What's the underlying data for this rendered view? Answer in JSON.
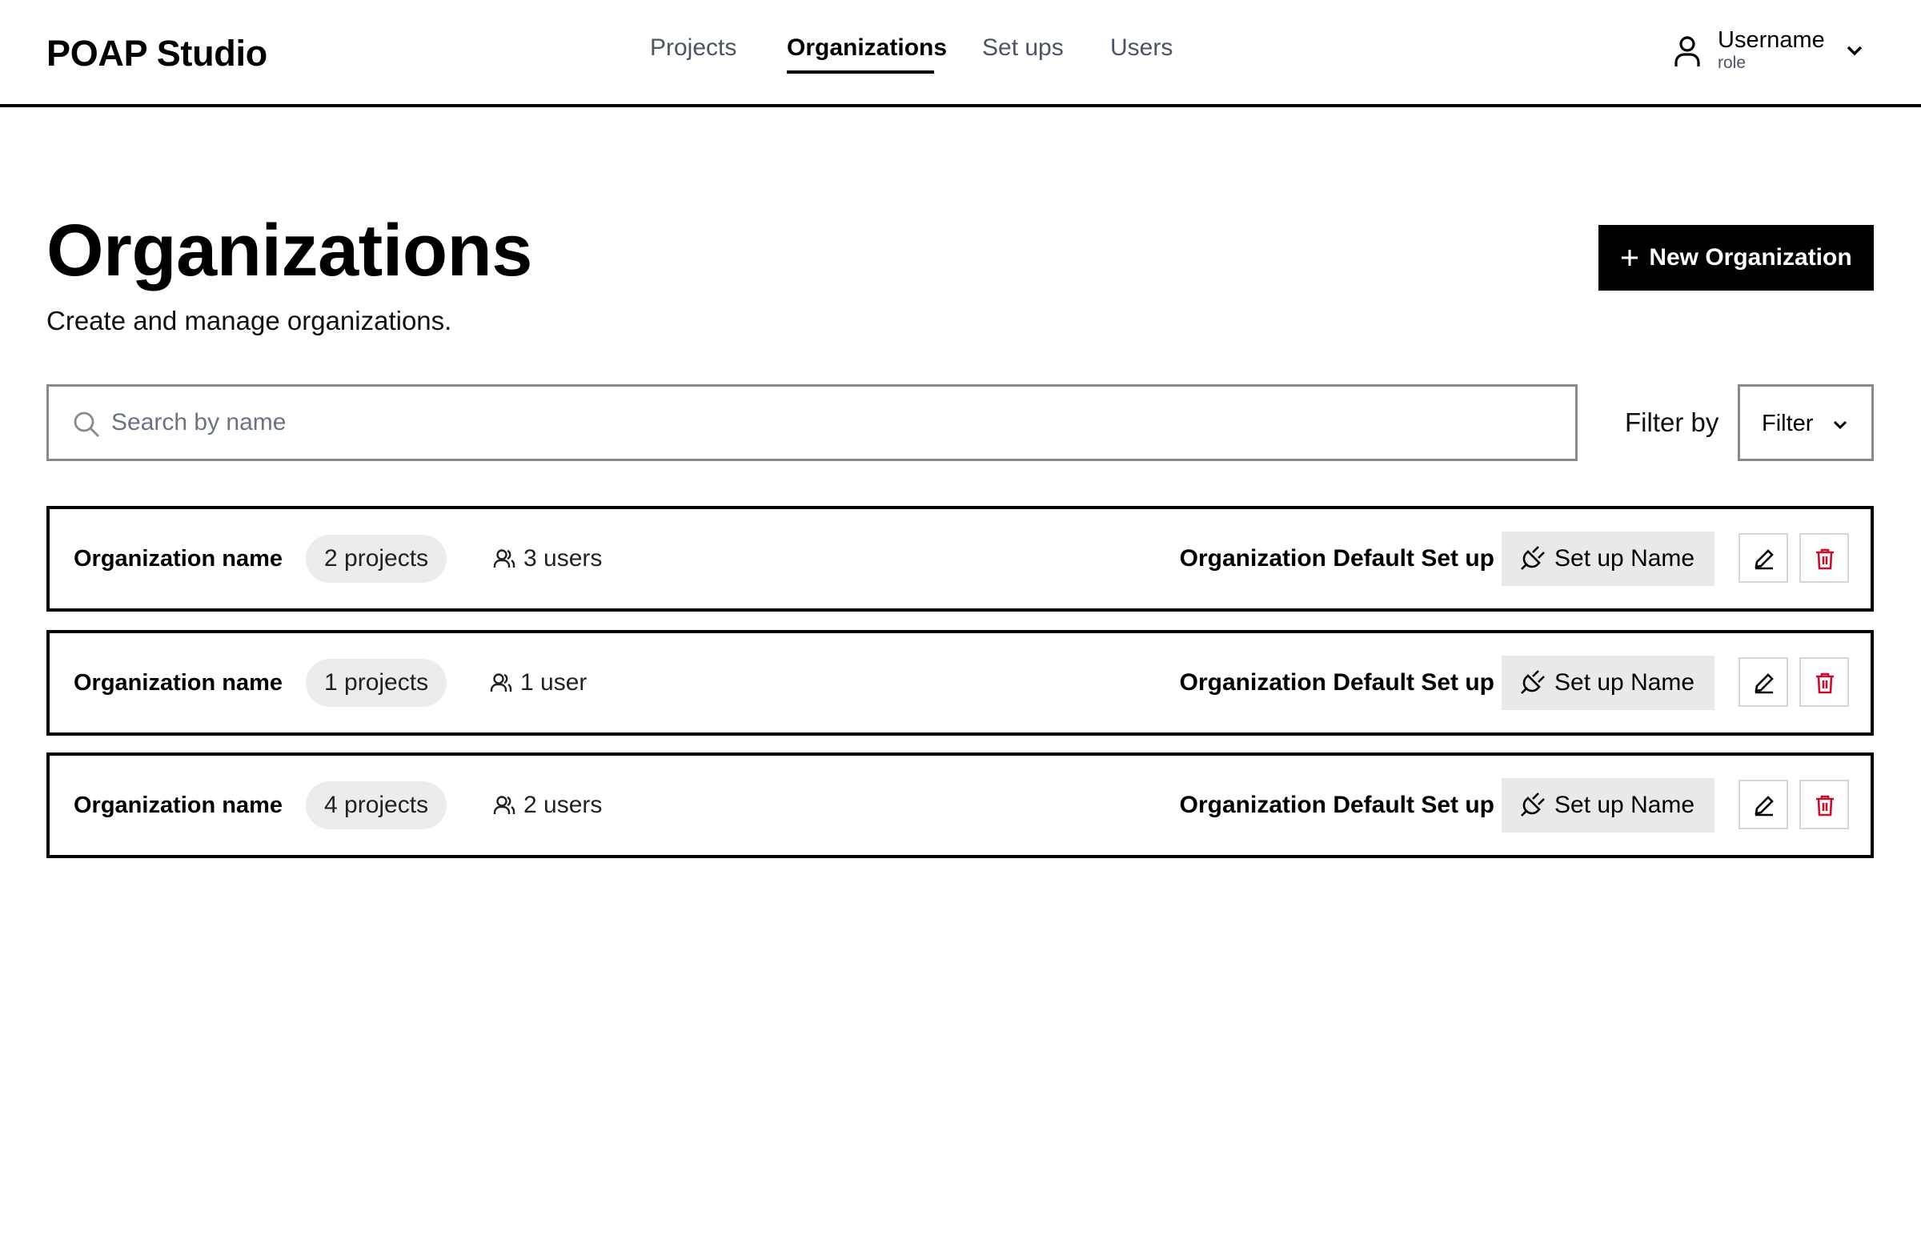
{
  "header": {
    "brand": "POAP Studio",
    "nav": [
      {
        "label": "Projects",
        "active": false
      },
      {
        "label": "Organizations",
        "active": true
      },
      {
        "label": "Set ups",
        "active": false
      },
      {
        "label": "Users",
        "active": false
      }
    ],
    "user": {
      "name": "Username",
      "role": "role"
    }
  },
  "page": {
    "title": "Organizations",
    "subtitle": "Create and manage organizations.",
    "new_button_label": "New Organization"
  },
  "search": {
    "placeholder": "Search by name",
    "value": ""
  },
  "filter": {
    "label": "Filter by",
    "value": "Filter"
  },
  "organizations": [
    {
      "name": "Organization name",
      "projects": "2 projects",
      "users": "3 users",
      "default_label": "Organization Default Set up",
      "setup": "Set up Name"
    },
    {
      "name": "Organization name",
      "projects": "1 projects",
      "users": "1 user",
      "default_label": "Organization Default Set up",
      "setup": "Set up Name"
    },
    {
      "name": "Organization name",
      "projects": "4 projects",
      "users": "2 users",
      "default_label": "Organization Default Set up",
      "setup": "Set up Name"
    }
  ],
  "colors": {
    "accent": "#000000",
    "badge_bg": "#ececec",
    "chip_bg": "#e9e9e9",
    "border_gray": "#8a8a8a",
    "delete_red": "#c8102e"
  },
  "icons": [
    "user-icon",
    "chevron-down-icon",
    "plus-icon",
    "search-icon",
    "users-icon",
    "plug-icon",
    "pencil-icon",
    "trash-icon"
  ]
}
